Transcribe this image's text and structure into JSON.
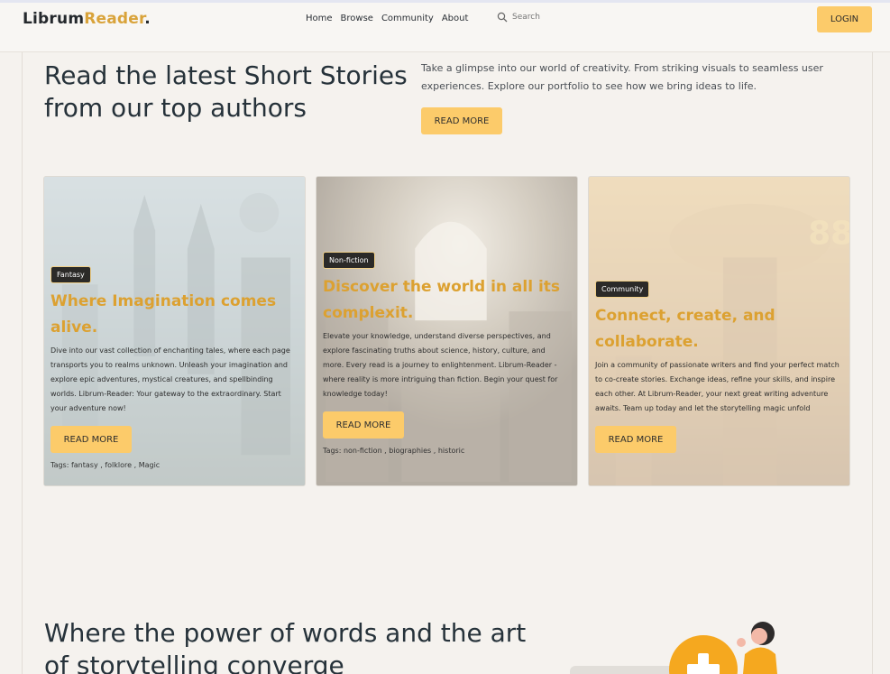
{
  "header": {
    "logo": {
      "part1": "Librum",
      "part2": "Reader",
      "part3": "."
    },
    "nav": [
      "Home",
      "Browse",
      "Community",
      "About"
    ],
    "search_placeholder": "Search",
    "login_label": "LOGIN"
  },
  "hero": {
    "title": "Read the latest Short Stories from our top authors",
    "description": "Take a glimpse into our world of creativity. From striking visuals to seamless user experiences. Explore our portfolio to see how we bring ideas to life.",
    "button_label": "READ MORE"
  },
  "cards": [
    {
      "badge": "Fantasy",
      "title": "Where Imagination comes alive.",
      "text": "Dive into our vast collection of enchanting tales, where each page transports you to realms unknown. Unleash your imagination and explore epic adventures, mystical creatures, and spellbinding worlds. Librum-Reader: Your gateway to the extraordinary. Start your adventure now!",
      "button_label": "READ MORE",
      "tags_prefix": "Tags:",
      "tags": [
        "fantasy",
        "folklore",
        "Magic"
      ]
    },
    {
      "badge": "Non-fiction",
      "title": "Discover the world in all its complexit.",
      "text": "Elevate your knowledge, understand diverse perspectives, and explore fascinating truths about science, history, culture, and more. Every read is a journey to enlightenment. Librum-Reader - where reality is more intriguing than fiction. Begin your quest for knowledge today!",
      "button_label": "READ MORE",
      "tags_prefix": "Tags:",
      "tags": [
        "non-fiction",
        "biographies",
        "historic"
      ]
    },
    {
      "badge": "Community",
      "title": "Connect, create, and collaborate.",
      "text": "Join a community of passionate writers and find your perfect match to co-create stories. Exchange ideas, refine your skills, and inspire each other. At Librum-Reader, your next great writing adventure awaits. Team up today and let the storytelling magic unfold",
      "button_label": "READ MORE",
      "tags_prefix": "",
      "tags": [],
      "bg_number": "88"
    }
  ],
  "section2": {
    "title": "Where the power of words and the art of storytelling converge"
  },
  "colors": {
    "accent": "#fccb6a",
    "title_gold": "#dca131",
    "page_bg": "#f5f2ee"
  }
}
